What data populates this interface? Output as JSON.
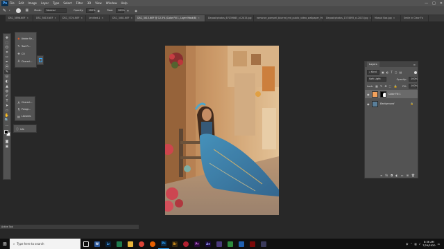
{
  "menubar": {
    "logo": "Ps",
    "items": [
      "File",
      "Edit",
      "Image",
      "Layer",
      "Type",
      "Select",
      "Filter",
      "3D",
      "View",
      "Window",
      "Help"
    ],
    "minimize": "—",
    "maximize": "□",
    "close": "✕"
  },
  "options": {
    "mode_label": "Mode:",
    "mode_value": "Normal",
    "opacity_label": "Opacity:",
    "opacity_value": "100%",
    "flow_label": "Flow:",
    "flow_value": "100%"
  },
  "tabs": [
    {
      "label": "DSC_3896.NEF",
      "active": false
    },
    {
      "label": "DSC_5813.NEF",
      "active": false
    },
    {
      "label": "DSC_5724.NEF",
      "active": false
    },
    {
      "label": "Untitled-1",
      "active": false
    },
    {
      "label": "DSC_3481.NEF",
      "active": false
    },
    {
      "label": "DSC_3415.NEF @ 12.5% (Color Fill 1, Layer Mask/8)",
      "active": true
    },
    {
      "label": "Depositphotos_67039865_xl-2015.jpg",
      "active": false
    },
    {
      "label": "romance_pompeii_blurred_red_public_video_wallpaper_96270-1.jpg",
      "active": false
    },
    {
      "label": "Depositphotos_1374895_xl-2015.jpg",
      "active": false
    },
    {
      "label": "Mosaic Box.jpg",
      "active": false
    },
    {
      "label": "Smile in Clear Fo",
      "active": false
    }
  ],
  "tools": [
    "✥",
    "⬚",
    "ʘ",
    "⌗",
    "✂",
    "✒",
    "⦿",
    "✎",
    "⛁",
    "◐",
    "▲",
    "◍",
    "✐",
    "T",
    "➤",
    "▭",
    "✋",
    "🔍",
    "…"
  ],
  "side_panels": {
    "group1": [
      "Adobe Se...",
      "Tool Pr...",
      "CO",
      "Charact..."
    ],
    "group2": [
      "Charact...",
      "Paragr...",
      "Libraries"
    ],
    "group3": [
      "Info"
    ]
  },
  "layers": {
    "tab": "Layers",
    "kind_label": "Kind",
    "blend": "Soft Light",
    "opacity_label": "Opacity:",
    "opacity_value": "100%",
    "lock_label": "Lock:",
    "fill_label": "Fill:",
    "fill_value": "100%",
    "rows": [
      {
        "name": "Color Fill 1",
        "thumb_color": "#f2a15c"
      },
      {
        "name": "Background",
        "thumb_color": "#5a7f9a"
      }
    ]
  },
  "statusbar": "Active Tool",
  "taskbar": {
    "search_placeholder": "Type here to search",
    "time": "8:36 AM",
    "date": "7/29/2020"
  },
  "colors": {
    "accent": "#31a8ff",
    "fill_thumb": "#f2a15c"
  }
}
